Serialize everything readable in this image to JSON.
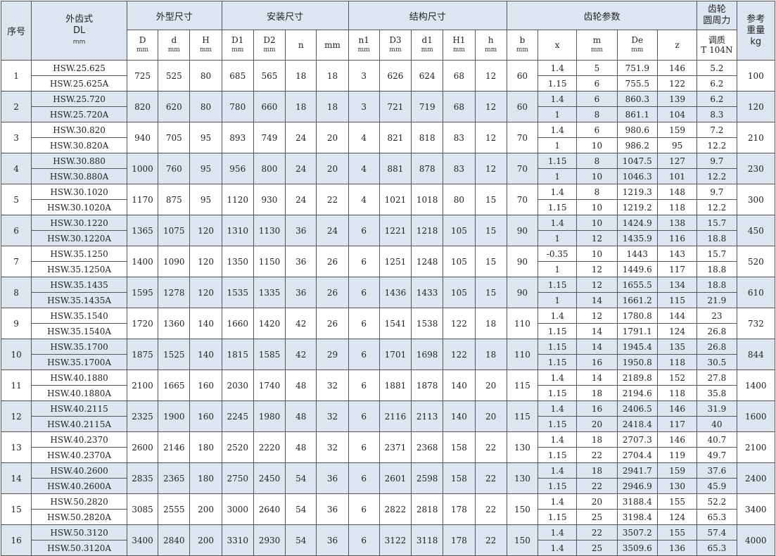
{
  "header": {
    "seq": "序号",
    "model_label": "外齿式",
    "model_code": "DL",
    "model_unit": "mm",
    "group_outer": "外型尺寸",
    "group_install": "安装尺寸",
    "group_struct": "结构尺寸",
    "group_gear": "齿轮参数",
    "force_label_1": "齿轮",
    "force_label_2": "圆周力",
    "weight_label_1": "参考",
    "weight_label_2": "重量",
    "weight_unit": "kg",
    "force_sub_1": "调质",
    "force_sub_2": "T 104N",
    "sub_columns": [
      {
        "name": "D",
        "unit": "mm"
      },
      {
        "name": "d",
        "unit": "mm"
      },
      {
        "name": "H",
        "unit": "mm"
      },
      {
        "name": "D1",
        "unit": "mm"
      },
      {
        "name": "D2",
        "unit": "mm"
      },
      {
        "name": "n",
        "unit": ""
      },
      {
        "name": "mm",
        "unit": ""
      },
      {
        "name": "n1",
        "unit": "mm"
      },
      {
        "name": "D3",
        "unit": "mm"
      },
      {
        "name": "d1",
        "unit": "mm"
      },
      {
        "name": "H1",
        "unit": "mm"
      },
      {
        "name": "h",
        "unit": "mm"
      },
      {
        "name": "b",
        "unit": "mm"
      },
      {
        "name": "x",
        "unit": ""
      },
      {
        "name": "m",
        "unit": "mm"
      },
      {
        "name": "De",
        "unit": "mm"
      },
      {
        "name": "z",
        "unit": ""
      }
    ]
  },
  "rows": [
    {
      "seq": "1",
      "models": [
        "HSW.25.625",
        "HSW.25.625A"
      ],
      "D": "725",
      "d": "525",
      "H": "80",
      "D1": "685",
      "D2": "565",
      "n": "18",
      "mm": "18",
      "n1": "3",
      "D3": "626",
      "d1": "624",
      "H1": "68",
      "h": "12",
      "b": "60",
      "gear": [
        [
          "1.4",
          "5",
          "751.9",
          "146",
          "5.2"
        ],
        [
          "1.15",
          "6",
          "755.5",
          "122",
          "6.2"
        ]
      ],
      "weight": "100"
    },
    {
      "seq": "2",
      "models": [
        "HSW.25.720",
        "HSW.25.720A"
      ],
      "D": "820",
      "d": "620",
      "H": "80",
      "D1": "780",
      "D2": "660",
      "n": "18",
      "mm": "18",
      "n1": "3",
      "D3": "721",
      "d1": "719",
      "H1": "68",
      "h": "12",
      "b": "60",
      "gear": [
        [
          "1.4",
          "6",
          "860.3",
          "139",
          "6.2"
        ],
        [
          "1",
          "8",
          "861.1",
          "104",
          "8.3"
        ]
      ],
      "weight": "120"
    },
    {
      "seq": "3",
      "models": [
        "HSW.30.820",
        "HSW.30.820A"
      ],
      "D": "940",
      "d": "705",
      "H": "95",
      "D1": "893",
      "D2": "749",
      "n": "24",
      "mm": "20",
      "n1": "4",
      "D3": "821",
      "d1": "818",
      "H1": "83",
      "h": "12",
      "b": "70",
      "gear": [
        [
          "1.4",
          "6",
          "980.6",
          "159",
          "7.2"
        ],
        [
          "1",
          "10",
          "986.2",
          "95",
          "12.2"
        ]
      ],
      "weight": "210"
    },
    {
      "seq": "4",
      "models": [
        "HSW.30.880",
        "HSW.30.880A"
      ],
      "D": "1000",
      "d": "760",
      "H": "95",
      "D1": "956",
      "D2": "800",
      "n": "24",
      "mm": "20",
      "n1": "4",
      "D3": "881",
      "d1": "878",
      "H1": "83",
      "h": "12",
      "b": "70",
      "gear": [
        [
          "1.15",
          "8",
          "1047.5",
          "127",
          "9.7"
        ],
        [
          "1",
          "10",
          "1046.3",
          "101",
          "12.2"
        ]
      ],
      "weight": "230"
    },
    {
      "seq": "5",
      "models": [
        "HSW.30.1020",
        "HSW.30.1020A"
      ],
      "D": "1170",
      "d": "875",
      "H": "95",
      "D1": "1120",
      "D2": "930",
      "n": "24",
      "mm": "22",
      "n1": "4",
      "D3": "1021",
      "d1": "1018",
      "H1": "80",
      "h": "15",
      "b": "70",
      "gear": [
        [
          "1.4",
          "8",
          "1219.3",
          "148",
          "9.7"
        ],
        [
          "1.15",
          "10",
          "1219.2",
          "118",
          "12.2"
        ]
      ],
      "weight": "300"
    },
    {
      "seq": "6",
      "models": [
        "HSW.30.1220",
        "HSW.30.1220A"
      ],
      "D": "1365",
      "d": "1075",
      "H": "120",
      "D1": "1310",
      "D2": "1130",
      "n": "36",
      "mm": "24",
      "n1": "6",
      "D3": "1221",
      "d1": "1218",
      "H1": "105",
      "h": "15",
      "b": "90",
      "gear": [
        [
          "1.4",
          "10",
          "1424.9",
          "138",
          "15.7"
        ],
        [
          "1",
          "12",
          "1435.9",
          "116",
          "18.8"
        ]
      ],
      "weight": "450"
    },
    {
      "seq": "7",
      "models": [
        "HSW.35.1250",
        "HSW.35.1250A"
      ],
      "D": "1400",
      "d": "1090",
      "H": "120",
      "D1": "1350",
      "D2": "1150",
      "n": "36",
      "mm": "26",
      "n1": "6",
      "D3": "1251",
      "d1": "1248",
      "H1": "105",
      "h": "15",
      "b": "90",
      "gear": [
        [
          "-0.35",
          "10",
          "1443",
          "143",
          "15.7"
        ],
        [
          "1",
          "12",
          "1449.6",
          "117",
          "18.8"
        ]
      ],
      "weight": "520"
    },
    {
      "seq": "8",
      "models": [
        "HSW.35.1435",
        "HSW.35.1435A"
      ],
      "D": "1595",
      "d": "1278",
      "H": "120",
      "D1": "1535",
      "D2": "1335",
      "n": "36",
      "mm": "26",
      "n1": "6",
      "D3": "1436",
      "d1": "1433",
      "H1": "105",
      "h": "15",
      "b": "90",
      "gear": [
        [
          "1.15",
          "12",
          "1655.5",
          "134",
          "18.8"
        ],
        [
          "1",
          "14",
          "1661.2",
          "115",
          "21.9"
        ]
      ],
      "weight": "610"
    },
    {
      "seq": "9",
      "models": [
        "HSW.35.1540",
        "HSW.35.1540A"
      ],
      "D": "1720",
      "d": "1360",
      "H": "140",
      "D1": "1660",
      "D2": "1420",
      "n": "42",
      "mm": "26",
      "n1": "6",
      "D3": "1541",
      "d1": "1538",
      "H1": "122",
      "h": "18",
      "b": "110",
      "gear": [
        [
          "1.4",
          "12",
          "1780.8",
          "144",
          "23"
        ],
        [
          "1.15",
          "14",
          "1791.1",
          "124",
          "26.8"
        ]
      ],
      "weight": "732"
    },
    {
      "seq": "10",
      "models": [
        "HSW.35.1700",
        "HSW.35.1700A"
      ],
      "D": "1875",
      "d": "1525",
      "H": "140",
      "D1": "1815",
      "D2": "1585",
      "n": "42",
      "mm": "29",
      "n1": "6",
      "D3": "1701",
      "d1": "1698",
      "H1": "122",
      "h": "18",
      "b": "110",
      "gear": [
        [
          "1.15",
          "14",
          "1945.4",
          "135",
          "26.8"
        ],
        [
          "1.15",
          "16",
          "1950.8",
          "118",
          "30.5"
        ]
      ],
      "weight": "844"
    },
    {
      "seq": "11",
      "models": [
        "HSW.40.1880",
        "HSW.40.1880A"
      ],
      "D": "2100",
      "d": "1665",
      "H": "160",
      "D1": "2030",
      "D2": "1740",
      "n": "48",
      "mm": "32",
      "n1": "6",
      "D3": "1881",
      "d1": "1878",
      "H1": "140",
      "h": "20",
      "b": "115",
      "gear": [
        [
          "1.4",
          "14",
          "2189.8",
          "152",
          "27.8"
        ],
        [
          "1.15",
          "18",
          "2194.6",
          "118",
          "35.8"
        ]
      ],
      "weight": "1400"
    },
    {
      "seq": "12",
      "models": [
        "HSW.40.2115",
        "HSW.40.2115A"
      ],
      "D": "2325",
      "d": "1900",
      "H": "160",
      "D1": "2245",
      "D2": "1980",
      "n": "48",
      "mm": "32",
      "n1": "6",
      "D3": "2116",
      "d1": "2113",
      "H1": "140",
      "h": "20",
      "b": "115",
      "gear": [
        [
          "1.4",
          "16",
          "2406.5",
          "146",
          "31.9"
        ],
        [
          "1.15",
          "20",
          "2418.4",
          "117",
          "40"
        ]
      ],
      "weight": "1600"
    },
    {
      "seq": "13",
      "models": [
        "HSW.40.2370",
        "HSW.40.2370A"
      ],
      "D": "2600",
      "d": "2146",
      "H": "180",
      "D1": "2520",
      "D2": "2220",
      "n": "48",
      "mm": "32",
      "n1": "6",
      "D3": "2371",
      "d1": "2368",
      "H1": "158",
      "h": "22",
      "b": "130",
      "gear": [
        [
          "1.4",
          "18",
          "2707.3",
          "146",
          "40.7"
        ],
        [
          "1.15",
          "22",
          "2704.4",
          "119",
          "49.7"
        ]
      ],
      "weight": "2100"
    },
    {
      "seq": "14",
      "models": [
        "HSW.40.2600",
        "HSW.40.2600A"
      ],
      "D": "2835",
      "d": "2365",
      "H": "180",
      "D1": "2750",
      "D2": "2450",
      "n": "54",
      "mm": "36",
      "n1": "6",
      "D3": "2601",
      "d1": "2598",
      "H1": "158",
      "h": "22",
      "b": "130",
      "gear": [
        [
          "1.4",
          "18",
          "2941.7",
          "159",
          "37.6"
        ],
        [
          "1.15",
          "22",
          "2946.9",
          "130",
          "45.9"
        ]
      ],
      "weight": "2400"
    },
    {
      "seq": "15",
      "models": [
        "HSW.50.2820",
        "HSW.50.2820A"
      ],
      "D": "3085",
      "d": "2555",
      "H": "200",
      "D1": "3000",
      "D2": "2640",
      "n": "54",
      "mm": "36",
      "n1": "6",
      "D3": "2822",
      "d1": "2818",
      "H1": "178",
      "h": "22",
      "b": "150",
      "gear": [
        [
          "1.4",
          "20",
          "3188.4",
          "155",
          "52.2"
        ],
        [
          "1.15",
          "25",
          "3198.4",
          "124",
          "65.3"
        ]
      ],
      "weight": "3400"
    },
    {
      "seq": "16",
      "models": [
        "HSW.50.3120",
        "HSW.50.3120A"
      ],
      "D": "3400",
      "d": "2840",
      "H": "200",
      "D1": "3310",
      "D2": "2930",
      "n": "54",
      "mm": "36",
      "n1": "6",
      "D3": "3122",
      "d1": "3118",
      "H1": "178",
      "h": "22",
      "b": "150",
      "gear": [
        [
          "1.4",
          "22",
          "3507.2",
          "155",
          "57.4"
        ],
        [
          "1.4",
          "25",
          "3509.6",
          "136",
          "65.3"
        ]
      ],
      "weight": "4000"
    }
  ]
}
